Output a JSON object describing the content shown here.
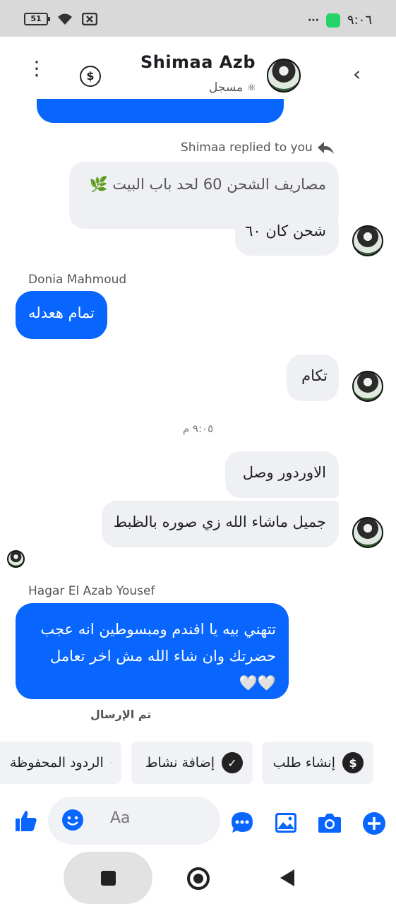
{
  "status_bar": {
    "battery": "51",
    "time": "٩:٠٦",
    "dots": "···"
  },
  "header": {
    "name": "Shimaa Azb",
    "subtitle": "مسجل",
    "back": "‹"
  },
  "messages": {
    "reply_note": "Shimaa replied to you",
    "quoted": "مصاريف الشحن 60 لحد باب البيت 🌿",
    "m1": "شحن كان ٦٠",
    "donia_name": "Donia Mahmoud",
    "donia_msg": "تمام هعدله",
    "m2": "تكام",
    "timestamp": "٩:٠٥ م",
    "m3": "الاوردور وصل",
    "m4": "جميل ماشاء الله زي صوره بالظبط",
    "hagar_name": "Hagar El Azab Yousef",
    "hagar_msg_line1": "تتهني بيه يا افندم ومبسوطين انه عجب",
    "hagar_msg_line2": "حضرتك وان شاء الله مش اخر تعامل",
    "hagar_msg_line3": "🤍🤍",
    "sent_status": "تم الإرسال"
  },
  "quick_replies": [
    {
      "label": "إنشاء طلب",
      "icon": "dollar-icon",
      "glyph": "$"
    },
    {
      "label": "إضافة نشاط",
      "icon": "check-circle-icon",
      "glyph": "✓"
    },
    {
      "label": "الردود المحفوظة",
      "icon": "chat-bubbles-icon",
      "glyph": ""
    }
  ],
  "composer": {
    "placeholder": "Aa"
  },
  "colors": {
    "accent": "#0866ff",
    "incoming_bubble": "#eef0f3"
  }
}
